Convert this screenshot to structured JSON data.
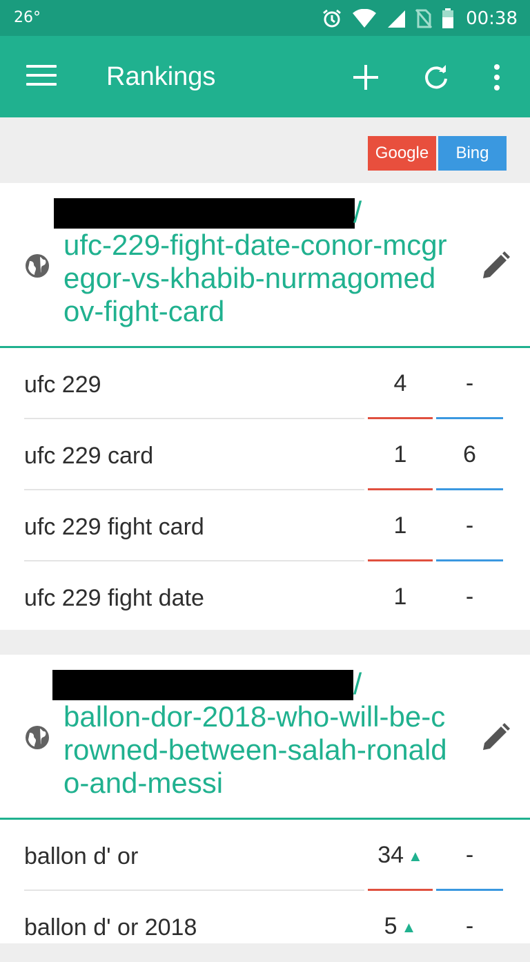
{
  "status_bar": {
    "temperature": "26°",
    "time": "00:38",
    "icons": [
      "alarm-icon",
      "wifi-icon",
      "signal-icon",
      "no-sim-icon",
      "battery-icon"
    ]
  },
  "app_bar": {
    "title": "Rankings",
    "icons": [
      "menu-icon",
      "add-icon",
      "refresh-icon",
      "more-vert-icon"
    ]
  },
  "engines": {
    "google": "Google",
    "bing": "Bing"
  },
  "colors": {
    "accent": "#20b18f",
    "google": "#e84f3d",
    "bing": "#3a98e0"
  },
  "pages": [
    {
      "slash": "/",
      "path": "ufc-229-fight-date-conor-mcgregor-vs-khabib-nurmagomedov-fight-card",
      "keywords": [
        {
          "keyword": "ufc 229",
          "google": "4",
          "bing": "-"
        },
        {
          "keyword": "ufc 229 card",
          "google": "1",
          "bing": "6"
        },
        {
          "keyword": "ufc 229 fight card",
          "google": "1",
          "bing": "-"
        },
        {
          "keyword": "ufc 229 fight date",
          "google": "1",
          "bing": "-"
        }
      ]
    },
    {
      "slash": "/",
      "path": "ballon-dor-2018-who-will-be-crowned-between-salah-ronaldo-and-messi",
      "keywords": [
        {
          "keyword": "ballon d' or",
          "google": "34",
          "google_trend": "▲",
          "bing": "-"
        },
        {
          "keyword": "ballon d' or 2018",
          "google": "5",
          "google_trend": "▲",
          "bing": "-"
        }
      ]
    }
  ]
}
